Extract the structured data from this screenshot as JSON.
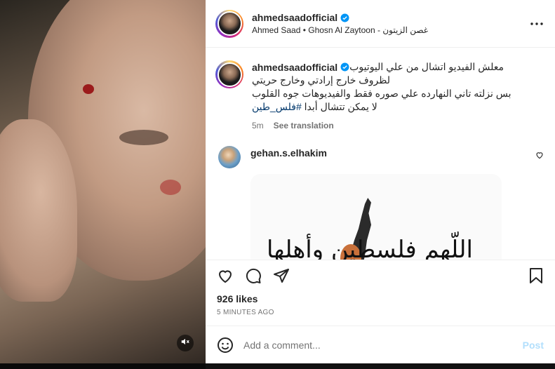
{
  "post": {
    "username": "ahmedsaadofficial",
    "subtitle": "Ahmed Saad • Ghosn Al Zaytoon - غصن الزيتون",
    "more_icon": "more-horizontal-icon"
  },
  "caption": {
    "username": "ahmedsaadofficial",
    "line1": "معلش الفيديو اتشال من علي اليوتيوب",
    "line2": "لظروف خارج إرادتي وخارج حريتي",
    "line3": "بس نزلته تاني النهارده علي صوره فقط والفيديوهات جوه القلوب",
    "line4_text": "لا يمكن تتشال أبدا",
    "hashtag": "#فلس_طين",
    "time": "5m",
    "see_translation": "See translation"
  },
  "comment": {
    "username": "gehan.s.elhakim",
    "image_text": "اللّهم فلسطين وأهلها"
  },
  "actions": {
    "icons": [
      "heart-icon",
      "comment-icon",
      "share-icon",
      "bookmark-icon"
    ]
  },
  "likes": "926 likes",
  "timestamp": "5 MINUTES AGO",
  "add_comment": {
    "placeholder": "Add a comment...",
    "post_label": "Post"
  },
  "media": {
    "mute_icon": "volume-muted-icon"
  }
}
